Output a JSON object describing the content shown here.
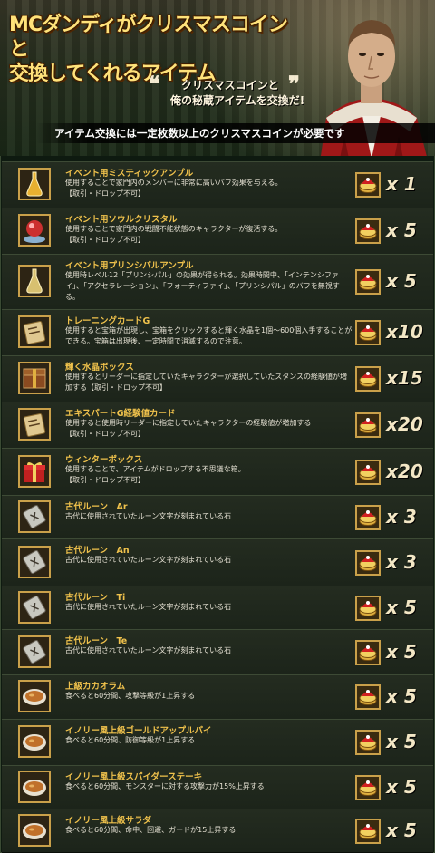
{
  "header": {
    "title_line1": "MCダンディがクリスマスコインと",
    "title_line2": "交換してくれるアイテム",
    "quote_line1": "クリスマスコインと",
    "quote_line2": "俺の秘蔵アイテムを交換だ!",
    "quote_open": "❝",
    "quote_close": "❞",
    "notice": "アイテム交換には一定枚数以上のクリスマスコインが必要です"
  },
  "colors": {
    "accent": "#f0c24c",
    "title": "#ffe27a",
    "background": "#0e1a10"
  },
  "items": [
    {
      "name": "イベント用ミスティックアンプル",
      "desc": "使用することで家門内のメンバーに非常に高いバフ効果を与える。\n【取引・ドロップ不可】",
      "qty": "x 1",
      "icon": "ampule-icon",
      "icon_color": "#e8b030"
    },
    {
      "name": "イベント用ソウルクリスタル",
      "desc": "使用することで家門内の戦闘不能状態のキャラクターが復活する。\n【取引・ドロップ不可】",
      "qty": "x 5",
      "icon": "crystal-icon",
      "icon_color": "#cc3030"
    },
    {
      "name": "イベント用プリンシパルアンプル",
      "desc": "使用時レベル12「プリンシパル」の効果が得られる。効果時間中、「インテンシファイ」、「アクセラレーション」、「フォーティファイ」、「プリンシパル」のバフを無視する。",
      "qty": "x 5",
      "icon": "ampule-icon",
      "icon_color": "#d8c070"
    },
    {
      "name": "トレーニングカードG",
      "desc": "使用すると宝箱が出現し、宝箱をクリックすると輝く水晶を1個～600個入手することができる。宝箱は出現後、一定時間で消滅するので注意。",
      "qty": "x10",
      "icon": "card-icon",
      "icon_color": "#e0c890"
    },
    {
      "name": "輝く水晶ボックス",
      "desc": "使用するとリーダーに指定していたキャラクターが選択していたスタンスの経験値が増加する【取引・ドロップ不可】",
      "qty": "x15",
      "icon": "box-icon",
      "icon_color": "#8a4a20"
    },
    {
      "name": "エキスパートG経験値カード",
      "desc": "使用すると使用時リーダーに指定していたキャラクターの経験値が増加する\n【取引・ドロップ不可】",
      "qty": "x20",
      "icon": "card-icon",
      "icon_color": "#e0c890"
    },
    {
      "name": "ウィンターボックス",
      "desc": "使用することで、アイテムがドロップする不思議な箱。\n【取引・ドロップ不可】",
      "qty": "x20",
      "icon": "gift-icon",
      "icon_color": "#c02020"
    },
    {
      "name": "古代ルーン　Ar",
      "desc": "古代に使用されていたルーン文字が刻まれている石",
      "qty": "x 3",
      "icon": "rune-icon",
      "icon_color": "#c8c8c0"
    },
    {
      "name": "古代ルーン　An",
      "desc": "古代に使用されていたルーン文字が刻まれている石",
      "qty": "x 3",
      "icon": "rune-icon",
      "icon_color": "#c8c8c0"
    },
    {
      "name": "古代ルーン　Ti",
      "desc": "古代に使用されていたルーン文字が刻まれている石",
      "qty": "x 5",
      "icon": "rune-icon",
      "icon_color": "#c8c8c0"
    },
    {
      "name": "古代ルーン　Te",
      "desc": "古代に使用されていたルーン文字が刻まれている石",
      "qty": "x 5",
      "icon": "rune-icon",
      "icon_color": "#c8c8c0"
    },
    {
      "name": "上級カカオラム",
      "desc": "食べると60分間、攻撃等級が1上昇する",
      "qty": "x 5",
      "icon": "soup-icon",
      "icon_color": "#c0702a"
    },
    {
      "name": "イノリー風上級ゴールドアップルパイ",
      "desc": "食べると60分間、防御等級が1上昇する",
      "qty": "x 5",
      "icon": "soup-icon",
      "icon_color": "#c0702a"
    },
    {
      "name": "イノリー風上級スパイダーステーキ",
      "desc": "食べると60分間、モンスターに対する攻撃力が15%上昇する",
      "qty": "x 5",
      "icon": "soup-icon",
      "icon_color": "#c0702a"
    },
    {
      "name": "イノリー風上級サラダ",
      "desc": "食べると60分間、命中、回避、ガードが15上昇する",
      "qty": "x 5",
      "icon": "soup-icon",
      "icon_color": "#c0702a"
    }
  ],
  "coin_icon": "christmas-coin-icon"
}
